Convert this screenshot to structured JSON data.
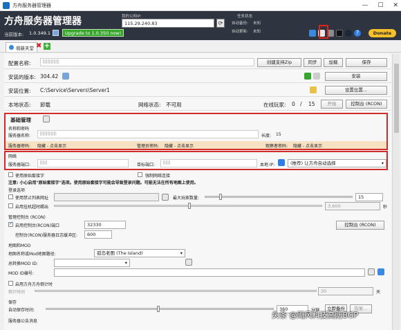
{
  "window": {
    "title": "方舟服务器管理器"
  },
  "header": {
    "app_title": "方舟服务器管理器",
    "version_label": "当前版本:",
    "version": "1.0.349.1",
    "upgrade": "Upgrade to 1.0.350 now!",
    "public_ip_label": "我的公网IP:",
    "public_ip": "115.29.240.83",
    "task_status": "任务状态",
    "auto_backup_label": "自动备份:",
    "auto_backup_value": "未知",
    "auto_update_label": "自动更新:",
    "auto_update_value": "未知",
    "donate": "Donate"
  },
  "tabs": [
    {
      "label": "萌新天堂"
    }
  ],
  "config": {
    "name_label": "配置名称:",
    "create_zip": "创建支持Zip",
    "sync": "同步",
    "load": "加载",
    "save": "保存",
    "installed_version_label": "安装的版本:",
    "installed_version": "304.42",
    "install": "安装",
    "install_location_label": "安装位置:",
    "install_location": "C:\\Service\\Servers\\Server1",
    "set_location": "设置位置...",
    "local_status_label": "本地状态:",
    "local_status": "卸载",
    "network_status_label": "网络状态:",
    "network_status": "不可用",
    "online_players_label": "在线玩家:",
    "online_players": "0",
    "players_sep": "/",
    "max_players": "15",
    "start": "开始",
    "console": "控制台 (RCON)"
  },
  "basic": {
    "title": "基础管理",
    "name_pw_label": "名称和密码",
    "server_name_label": "服务器名称:",
    "length_label": "长度:",
    "length": "15",
    "server_pw_label": "服务器密码:",
    "server_pw": "隐藏 - 点击显示",
    "admin_pw_label": "管理员密码:",
    "admin_pw": "隐藏 - 点击显示",
    "spectator_pw_label": "观察者密码:",
    "spectator_pw": "隐藏 - 点击显示"
  },
  "network": {
    "title": "网络",
    "server_port_label": "服务器端口:",
    "query_port_label": "目标端口:",
    "local_ip_label": "本地 IP:",
    "local_ip_select": "(推荐) 让方舟自动选择",
    "force_network_label": "强制网络连接"
  },
  "misc": {
    "use_raw_sockets": "使用原始套接字",
    "note": "注意: 小心启用\"原始套接字\"选项。使用原始套接字可能会导致登录问题。可能无法在所有地图上使用。",
    "login_options": "登录选项",
    "use_ban_list": "使用禁止列表网址",
    "max_players_label": "最大玩家数量:",
    "max_players": "15",
    "kick_idle": "启用挂机超时踢出",
    "idle_value": "3,600",
    "idle_unit": "秒",
    "admin_console": "管理控制台 (RCON)",
    "enable_rcon": "启用控制台(RCON)端口",
    "rcon_port": "32330",
    "rcon_log_label": "控制台(RCON)服务器日志缓冲区:",
    "rcon_log": "600",
    "rcon_button": "控制台 (RCON)",
    "map_mod": "地图和MOD",
    "map_name_label": "地图名称或Mod地图路径:",
    "map_name": "孤岛老图 (The Island)",
    "total_mod_label": "总转换MOD ID:",
    "mod_id_label": "MOD ID编号:",
    "enable_ark_countdown": "启用方舟方舟倒计时",
    "countdown_label": "倒计时间",
    "countdown_value": "30",
    "countdown_unit": "天",
    "save_section": "保存",
    "auto_save_label": "自动保存时间:",
    "auto_save_value": "360",
    "auto_save_unit": "分钟",
    "backup_now": "立即备份",
    "restore": "恢复...",
    "server_messages": "服务器公告消息"
  },
  "watermark": "头条 @飓风科技高防BGP"
}
